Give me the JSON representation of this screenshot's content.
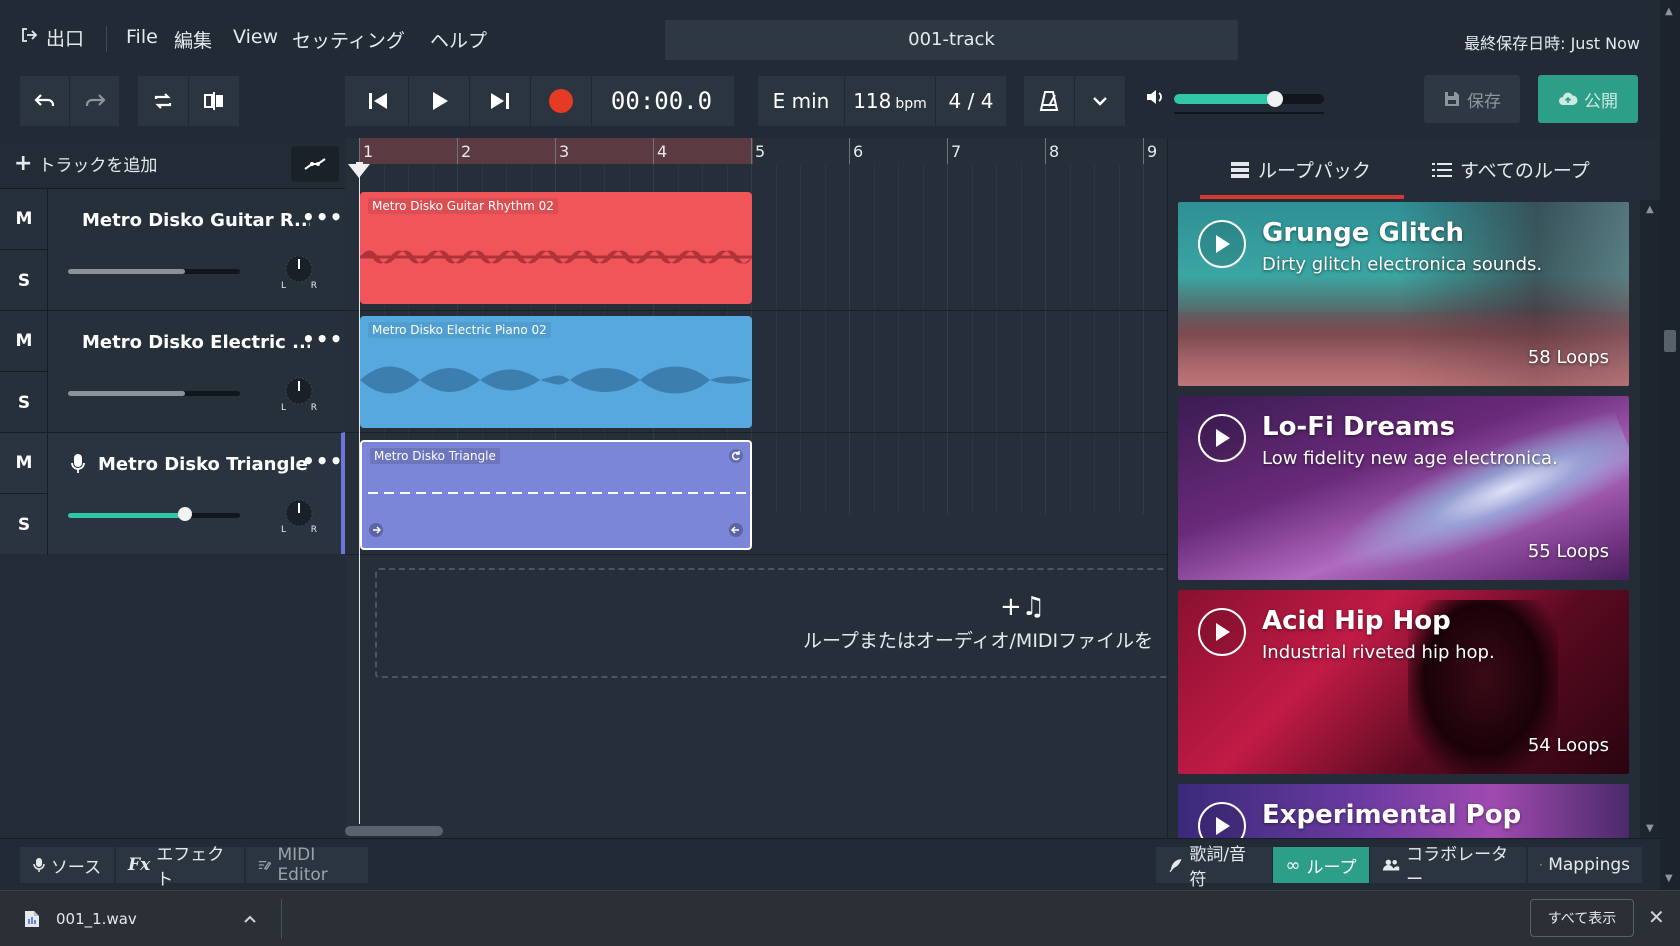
{
  "menu": {
    "exit_label": "出口",
    "items": [
      "File",
      "編集",
      "View",
      "セッティング",
      "ヘルプ"
    ],
    "project_title": "001-track",
    "saved_status": "最終保存日時: Just Now"
  },
  "toolbar": {
    "time": "00:00.0",
    "key": "E min",
    "tempo": "118",
    "tempo_unit": "bpm",
    "signature": "4 / 4",
    "master_volume": 0.67,
    "save_label": "保存",
    "publish_label": "公開"
  },
  "tracks_panel": {
    "add_track_label": "トラックを追加",
    "tracks": [
      {
        "mute": "M",
        "solo": "S",
        "name": "Metro Disko Guitar R...",
        "volume": 0.68,
        "pan_left": "L",
        "pan_right": "R"
      },
      {
        "mute": "M",
        "solo": "S",
        "name": "Metro Disko Electric ...",
        "volume": 0.68,
        "pan_left": "L",
        "pan_right": "R"
      },
      {
        "mute": "M",
        "solo": "S",
        "name": "Metro Disko Triangle",
        "volume": 0.68,
        "pan_left": "L",
        "pan_right": "R"
      }
    ]
  },
  "timeline": {
    "bars": [
      "1",
      "2",
      "3",
      "4",
      "5",
      "6",
      "7",
      "8",
      "9"
    ],
    "clips": [
      {
        "label": "Metro Disko Guitar Rhythm 02",
        "color": "#f0555a"
      },
      {
        "label": "Metro Disko Electric Piano 02",
        "color": "#56a8de"
      },
      {
        "label": "Metro Disko Triangle",
        "color": "#7c86d8"
      }
    ],
    "drop_hint": "ループまたはオーディオ/MIDIファイルを"
  },
  "right_panel": {
    "tabs": [
      "ループパック",
      "すべてのループ"
    ],
    "loop_packs": [
      {
        "title": "Grunge Glitch",
        "description": "Dirty glitch electronica sounds.",
        "count": "58 Loops"
      },
      {
        "title": "Lo-Fi Dreams",
        "description": "Low fidelity new age electronica.",
        "count": "55 Loops"
      },
      {
        "title": "Acid Hip Hop",
        "description": "Industrial riveted hip hop.",
        "count": "54 Loops"
      },
      {
        "title": "Experimental Pop",
        "description": "",
        "count": ""
      }
    ]
  },
  "bottom": {
    "left_tabs": [
      "ソース",
      "エフェクト",
      "MIDI Editor"
    ],
    "right_tabs": [
      "歌詞/音符",
      "ループ",
      "コラボレーター",
      "Mappings"
    ]
  },
  "downloads": {
    "file_name": "001_1.wav",
    "show_all": "すべて表示"
  },
  "colors": {
    "accent_green": "#2d9e87",
    "accent_red": "#d43a2b",
    "record_red": "#e53a24"
  }
}
